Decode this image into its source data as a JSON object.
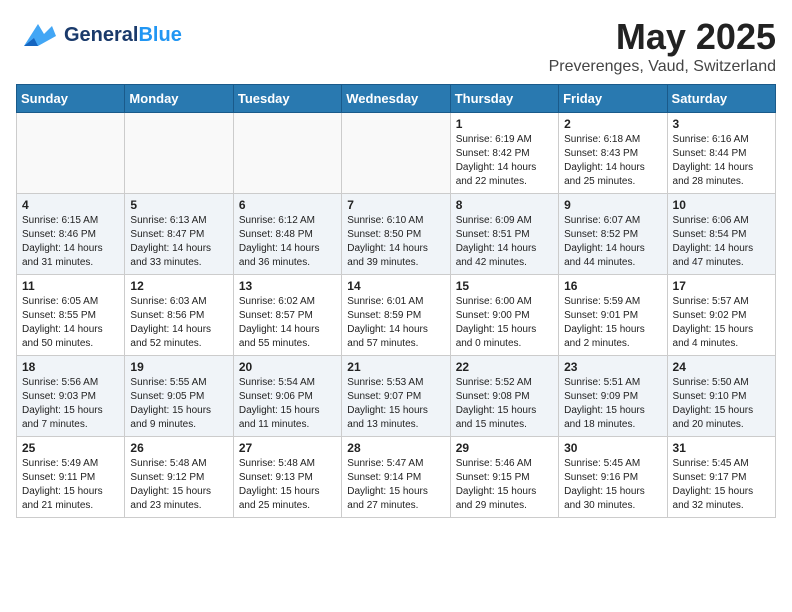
{
  "header": {
    "logo_general": "General",
    "logo_blue": "Blue",
    "title": "May 2025",
    "subtitle": "Preverenges, Vaud, Switzerland"
  },
  "weekdays": [
    "Sunday",
    "Monday",
    "Tuesday",
    "Wednesday",
    "Thursday",
    "Friday",
    "Saturday"
  ],
  "weeks": [
    [
      {
        "day": "",
        "info": ""
      },
      {
        "day": "",
        "info": ""
      },
      {
        "day": "",
        "info": ""
      },
      {
        "day": "",
        "info": ""
      },
      {
        "day": "1",
        "info": "Sunrise: 6:19 AM\nSunset: 8:42 PM\nDaylight: 14 hours\nand 22 minutes."
      },
      {
        "day": "2",
        "info": "Sunrise: 6:18 AM\nSunset: 8:43 PM\nDaylight: 14 hours\nand 25 minutes."
      },
      {
        "day": "3",
        "info": "Sunrise: 6:16 AM\nSunset: 8:44 PM\nDaylight: 14 hours\nand 28 minutes."
      }
    ],
    [
      {
        "day": "4",
        "info": "Sunrise: 6:15 AM\nSunset: 8:46 PM\nDaylight: 14 hours\nand 31 minutes."
      },
      {
        "day": "5",
        "info": "Sunrise: 6:13 AM\nSunset: 8:47 PM\nDaylight: 14 hours\nand 33 minutes."
      },
      {
        "day": "6",
        "info": "Sunrise: 6:12 AM\nSunset: 8:48 PM\nDaylight: 14 hours\nand 36 minutes."
      },
      {
        "day": "7",
        "info": "Sunrise: 6:10 AM\nSunset: 8:50 PM\nDaylight: 14 hours\nand 39 minutes."
      },
      {
        "day": "8",
        "info": "Sunrise: 6:09 AM\nSunset: 8:51 PM\nDaylight: 14 hours\nand 42 minutes."
      },
      {
        "day": "9",
        "info": "Sunrise: 6:07 AM\nSunset: 8:52 PM\nDaylight: 14 hours\nand 44 minutes."
      },
      {
        "day": "10",
        "info": "Sunrise: 6:06 AM\nSunset: 8:54 PM\nDaylight: 14 hours\nand 47 minutes."
      }
    ],
    [
      {
        "day": "11",
        "info": "Sunrise: 6:05 AM\nSunset: 8:55 PM\nDaylight: 14 hours\nand 50 minutes."
      },
      {
        "day": "12",
        "info": "Sunrise: 6:03 AM\nSunset: 8:56 PM\nDaylight: 14 hours\nand 52 minutes."
      },
      {
        "day": "13",
        "info": "Sunrise: 6:02 AM\nSunset: 8:57 PM\nDaylight: 14 hours\nand 55 minutes."
      },
      {
        "day": "14",
        "info": "Sunrise: 6:01 AM\nSunset: 8:59 PM\nDaylight: 14 hours\nand 57 minutes."
      },
      {
        "day": "15",
        "info": "Sunrise: 6:00 AM\nSunset: 9:00 PM\nDaylight: 15 hours\nand 0 minutes."
      },
      {
        "day": "16",
        "info": "Sunrise: 5:59 AM\nSunset: 9:01 PM\nDaylight: 15 hours\nand 2 minutes."
      },
      {
        "day": "17",
        "info": "Sunrise: 5:57 AM\nSunset: 9:02 PM\nDaylight: 15 hours\nand 4 minutes."
      }
    ],
    [
      {
        "day": "18",
        "info": "Sunrise: 5:56 AM\nSunset: 9:03 PM\nDaylight: 15 hours\nand 7 minutes."
      },
      {
        "day": "19",
        "info": "Sunrise: 5:55 AM\nSunset: 9:05 PM\nDaylight: 15 hours\nand 9 minutes."
      },
      {
        "day": "20",
        "info": "Sunrise: 5:54 AM\nSunset: 9:06 PM\nDaylight: 15 hours\nand 11 minutes."
      },
      {
        "day": "21",
        "info": "Sunrise: 5:53 AM\nSunset: 9:07 PM\nDaylight: 15 hours\nand 13 minutes."
      },
      {
        "day": "22",
        "info": "Sunrise: 5:52 AM\nSunset: 9:08 PM\nDaylight: 15 hours\nand 15 minutes."
      },
      {
        "day": "23",
        "info": "Sunrise: 5:51 AM\nSunset: 9:09 PM\nDaylight: 15 hours\nand 18 minutes."
      },
      {
        "day": "24",
        "info": "Sunrise: 5:50 AM\nSunset: 9:10 PM\nDaylight: 15 hours\nand 20 minutes."
      }
    ],
    [
      {
        "day": "25",
        "info": "Sunrise: 5:49 AM\nSunset: 9:11 PM\nDaylight: 15 hours\nand 21 minutes."
      },
      {
        "day": "26",
        "info": "Sunrise: 5:48 AM\nSunset: 9:12 PM\nDaylight: 15 hours\nand 23 minutes."
      },
      {
        "day": "27",
        "info": "Sunrise: 5:48 AM\nSunset: 9:13 PM\nDaylight: 15 hours\nand 25 minutes."
      },
      {
        "day": "28",
        "info": "Sunrise: 5:47 AM\nSunset: 9:14 PM\nDaylight: 15 hours\nand 27 minutes."
      },
      {
        "day": "29",
        "info": "Sunrise: 5:46 AM\nSunset: 9:15 PM\nDaylight: 15 hours\nand 29 minutes."
      },
      {
        "day": "30",
        "info": "Sunrise: 5:45 AM\nSunset: 9:16 PM\nDaylight: 15 hours\nand 30 minutes."
      },
      {
        "day": "31",
        "info": "Sunrise: 5:45 AM\nSunset: 9:17 PM\nDaylight: 15 hours\nand 32 minutes."
      }
    ]
  ]
}
